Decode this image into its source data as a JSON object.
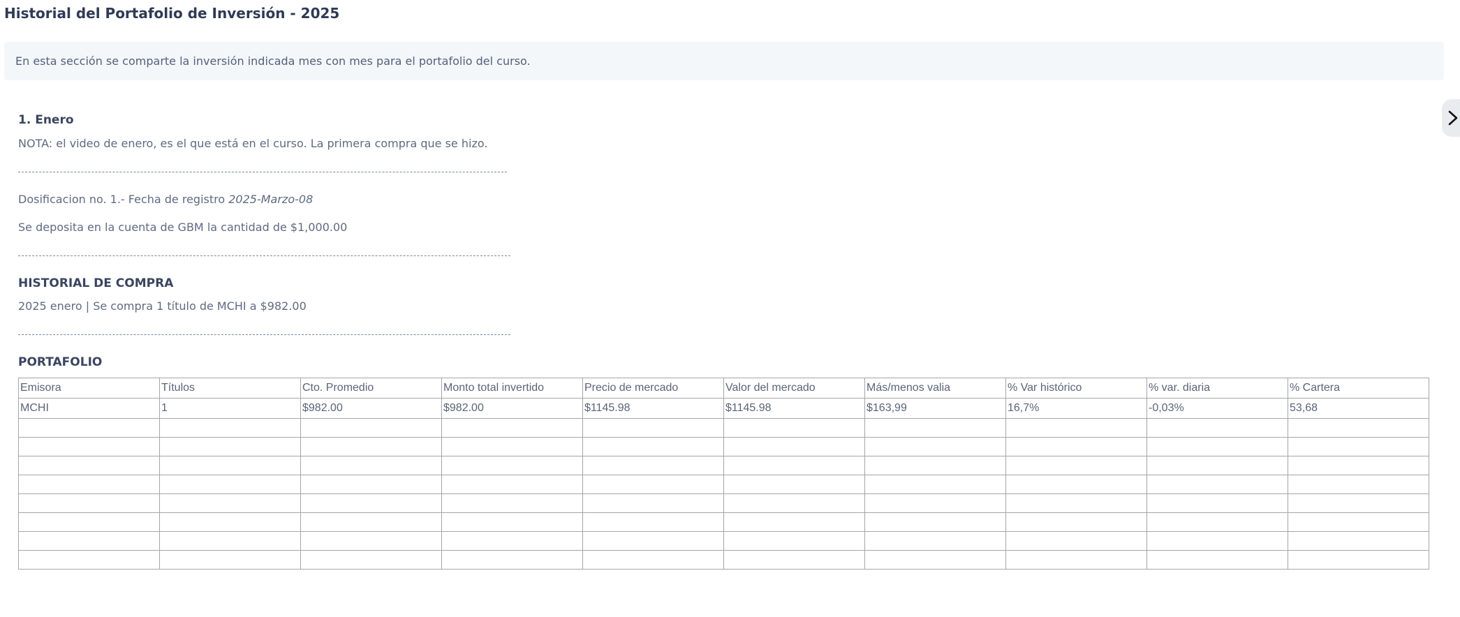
{
  "page": {
    "title": "Historial del Portafolio de Inversión - 2025",
    "intro": "En esta sección se comparte la inversión indicada mes con mes para el portafolio del curso."
  },
  "section": {
    "heading": "1. Enero",
    "note": "NOTA: el video de enero, es el que está en el curso. La primera compra que se hizo.",
    "separator_short": "-----------------------------------------------------------------------------------------------------------------------------------------------",
    "separator_long": "---------------------------------------------------------------------------------------------------------------------------------------------------",
    "dosificacion_prefix": "Dosificacion no. 1.- Fecha de registro ",
    "dosificacion_date": "2025-Marzo-08",
    "deposit": "Se deposita en la cuenta de GBM la cantidad de $1,000.00",
    "history_heading": "HISTORIAL DE COMPRA",
    "history_entry": "2025 enero | Se compra 1 título de MCHI a $982.00",
    "portfolio_heading": "PORTAFOLIO"
  },
  "table": {
    "headers": [
      "Emisora",
      "Títulos",
      "Cto. Promedio",
      "Monto total invertido",
      "Precio de mercado",
      "Valor del mercado",
      "Más/menos valia",
      "% Var histórico",
      "% var. diaria",
      "% Cartera"
    ],
    "rows": [
      [
        "MCHI",
        "1",
        "$982.00",
        "$982.00",
        "$1145.98",
        "$1145.98",
        "$163,99",
        "16,7%",
        "-0,03%",
        "53,68"
      ],
      [
        "",
        "",
        "",
        "",
        "",
        "",
        "",
        "",
        "",
        ""
      ],
      [
        "",
        "",
        "",
        "",
        "",
        "",
        "",
        "",
        "",
        ""
      ],
      [
        "",
        "",
        "",
        "",
        "",
        "",
        "",
        "",
        "",
        ""
      ],
      [
        "",
        "",
        "",
        "",
        "",
        "",
        "",
        "",
        "",
        ""
      ],
      [
        "",
        "",
        "",
        "",
        "",
        "",
        "",
        "",
        "",
        ""
      ],
      [
        "",
        "",
        "",
        "",
        "",
        "",
        "",
        "",
        "",
        ""
      ],
      [
        "",
        "",
        "",
        "",
        "",
        "",
        "",
        "",
        "",
        ""
      ],
      [
        "",
        "",
        "",
        "",
        "",
        "",
        "",
        "",
        "",
        ""
      ]
    ]
  },
  "icons": {
    "side_toggle": "chevron-right-icon"
  }
}
